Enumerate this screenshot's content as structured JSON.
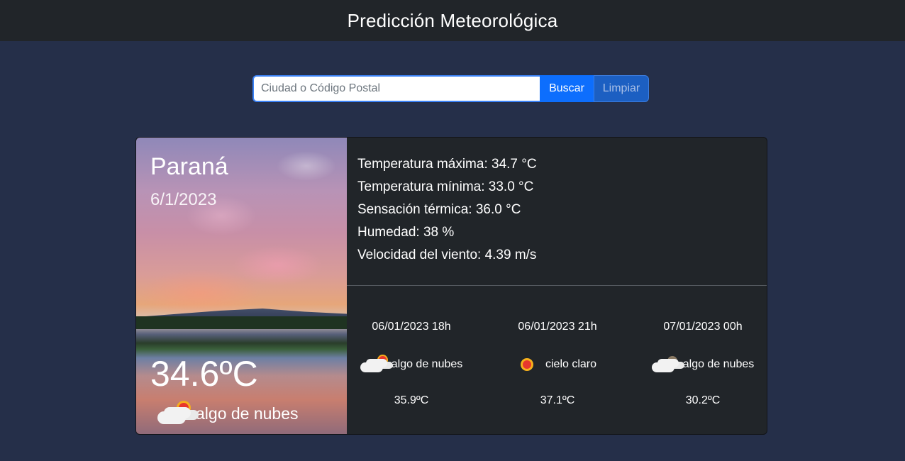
{
  "header": {
    "title": "Predicción Meteorológica"
  },
  "search": {
    "placeholder": "Ciudad o Código Postal",
    "value": "",
    "search_label": "Buscar",
    "clear_label": "Limpiar"
  },
  "current": {
    "city": "Paraná",
    "date": "6/1/2023",
    "temperature": "34.6ºC",
    "condition": "algo de nubes",
    "icon": "cloud-sun-icon"
  },
  "details": {
    "max_temp": "Temperatura máxima: 34.7 °C",
    "min_temp": "Temperatura mínima: 33.0 °C",
    "feels_like": "Sensación térmica: 36.0 °C",
    "humidity": "Humedad: 38 %",
    "wind": "Velocidad del viento: 4.39 m/s"
  },
  "forecast": [
    {
      "datetime": "06/01/2023 18h",
      "condition": "algo de nubes",
      "temp": "35.9ºC",
      "icon": "cloud-sun-icon"
    },
    {
      "datetime": "06/01/2023 21h",
      "condition": "cielo claro",
      "temp": "37.1ºC",
      "icon": "sun-icon"
    },
    {
      "datetime": "07/01/2023 00h",
      "condition": "algo de nubes",
      "temp": "30.2ºC",
      "icon": "cloud-moon-icon"
    }
  ],
  "colors": {
    "background": "#252f49",
    "topbar": "#212529",
    "primary": "#0d6efd",
    "card": "#212529"
  }
}
